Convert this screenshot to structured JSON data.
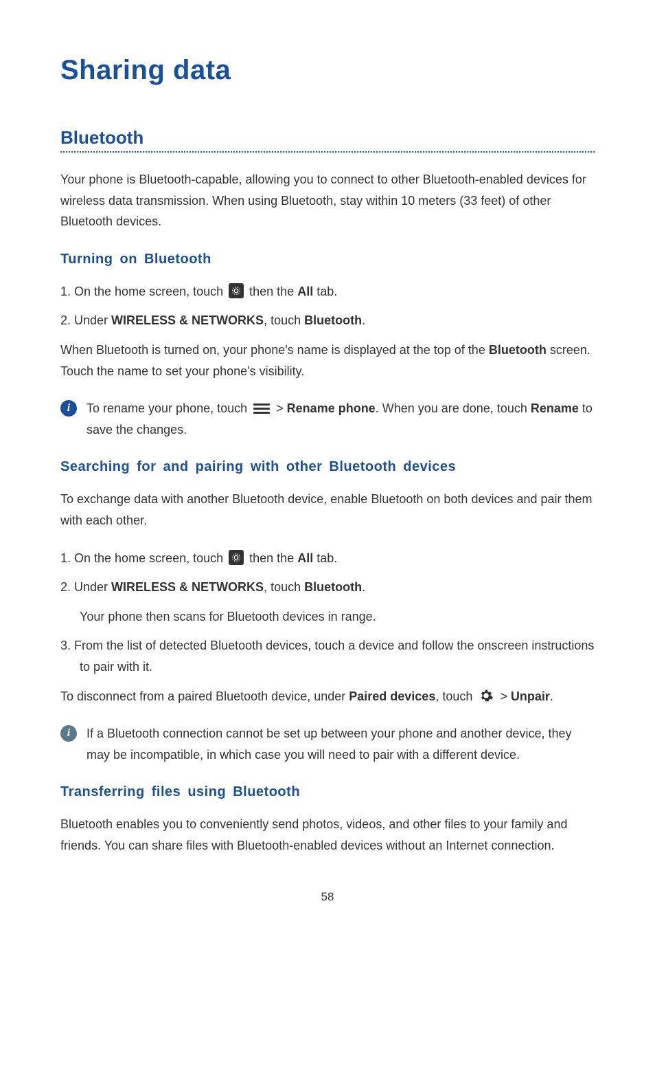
{
  "title": "Sharing data",
  "section1": {
    "heading": "Bluetooth",
    "intro": "Your phone is Bluetooth-capable, allowing you to connect to other Bluetooth-enabled devices for wireless data transmission. When using Bluetooth, stay within 10 meters (33 feet) of other Bluetooth devices."
  },
  "sub1": {
    "heading": "Turning on Bluetooth",
    "step1_a": "1. On the home screen, touch ",
    "step1_b": " then the ",
    "step1_all": "All",
    "step1_c": " tab.",
    "step2_a": "2. Under ",
    "step2_wn": "WIRELESS & NETWORKS",
    "step2_b": ", touch ",
    "step2_bt": "Bluetooth",
    "step2_c": ".",
    "para_a": "When Bluetooth is turned on, your phone's name is displayed at the top of the ",
    "para_bt": "Bluetooth",
    "para_b": " screen. Touch the name to set your phone's visibility.",
    "note_a": "To rename your phone, touch ",
    "note_gt": " > ",
    "note_rp": "Rename phone",
    "note_b": ". When you are done, touch ",
    "note_rn": "Rename",
    "note_c": " to save the changes."
  },
  "sub2": {
    "heading": "Searching for and pairing with other Bluetooth devices",
    "intro": "To exchange data with another Bluetooth device, enable Bluetooth on both devices and pair them with each other.",
    "step1_a": "1. On the home screen, touch ",
    "step1_b": " then the ",
    "step1_all": "All",
    "step1_c": " tab.",
    "step2_a": "2. Under ",
    "step2_wn": "WIRELESS & NETWORKS",
    "step2_b": ", touch ",
    "step2_bt": "Bluetooth",
    "step2_c": ".",
    "step2_body": "Your phone then scans for Bluetooth devices in range.",
    "step3": "3. From the list of detected Bluetooth devices, touch a device and follow the onscreen instructions to pair with it.",
    "para_a": "To disconnect from a paired Bluetooth device, under ",
    "para_pd": "Paired devices",
    "para_b": ", touch ",
    "para_gt": " > ",
    "para_up": "Unpair",
    "para_c": ".",
    "note": "If a Bluetooth connection cannot be set up between your phone and another device, they may be incompatible, in which case you will need to pair with a different device."
  },
  "sub3": {
    "heading": "Transferring files using Bluetooth",
    "intro": "Bluetooth enables you to conveniently send photos, videos, and other files to your family and friends. You can share files with Bluetooth-enabled devices without an Internet connection."
  },
  "pageNumber": "58"
}
